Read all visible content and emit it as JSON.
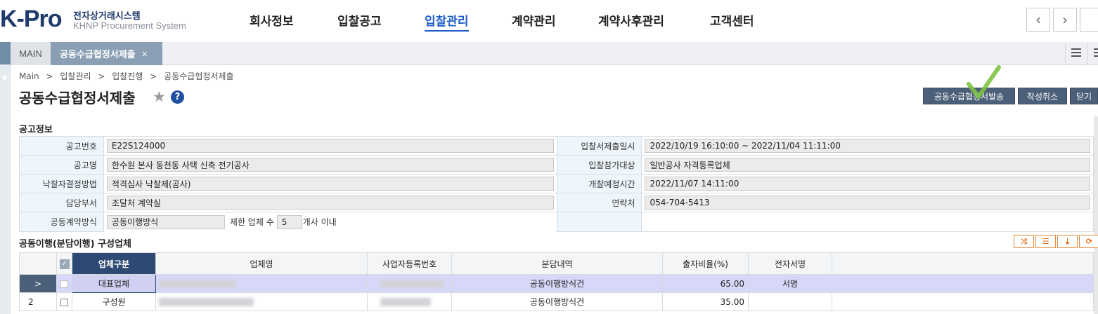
{
  "logo": {
    "main": "K-Pro",
    "sub_ko": "전자상거래시스템",
    "sub_en": "KHNP Procurement System"
  },
  "gnb": [
    "회사정보",
    "입찰공고",
    "입찰관리",
    "계약관리",
    "계약사후관리",
    "고객센터"
  ],
  "gnb_active": "입찰관리",
  "tabs": {
    "main": "MAIN",
    "active": "공동수급협정서제출",
    "close": "×"
  },
  "breadcrumb": [
    "Main",
    ">",
    "입찰관리",
    ">",
    "입찰진행",
    ">",
    "공동수급협정서제출"
  ],
  "page_title": "공동수급협정서제출",
  "help": "?",
  "buttons": {
    "send": "공동수급협정서발송",
    "cancel": "작성취소",
    "close": "닫기"
  },
  "section1_title": "공고정보",
  "info": {
    "notice_no_label": "공고번호",
    "notice_no": "E22S124000",
    "submit_period_label": "입찰서제출일시",
    "submit_period": "2022/10/19 16:10:00 ~ 2022/11/04 11:11:00",
    "notice_name_label": "공고명",
    "notice_name": "한수원 본사 동천동 사택 신축 전기공사",
    "target_label": "입찰참가대상",
    "target": "일반공사 자격등록업체",
    "method_label": "낙찰자결정방법",
    "method": "적격심사 낙찰제(공사)",
    "open_time_label": "개찰예정시간",
    "open_time": "2022/11/07 14:11:00",
    "dept_label": "담당부서",
    "dept": "조달처 계약실",
    "contact_label": "연락처",
    "contact": "054-704-5413",
    "contract_type_label": "공동계약방식",
    "contract_type": "공동이행방식",
    "limit_prefix": "제한 업체 수",
    "limit_value": "5",
    "limit_suffix": "개사 이내"
  },
  "section2_title": "공동이행(분담이행) 구성업체",
  "grid": {
    "headers": {
      "type": "업체구분",
      "name": "업체명",
      "biz_no": "사업자등록번호",
      "share": "분담내역",
      "ratio": "출자비율(%)",
      "sign": "전자서명"
    },
    "rows": [
      {
        "idx": ">",
        "type": "대표업체",
        "share": "공동이행방식건",
        "ratio": "65.00",
        "sign": "서명"
      },
      {
        "idx": "2",
        "type": "구성원",
        "share": "공동이행방식건",
        "ratio": "35.00",
        "sign": ""
      }
    ]
  },
  "colors": {
    "brand": "#1f3a6b",
    "active_nav": "#1e5ec8",
    "button": "#4b5f79",
    "check": "#7dc242",
    "selected_row": "#d7d8f9"
  }
}
